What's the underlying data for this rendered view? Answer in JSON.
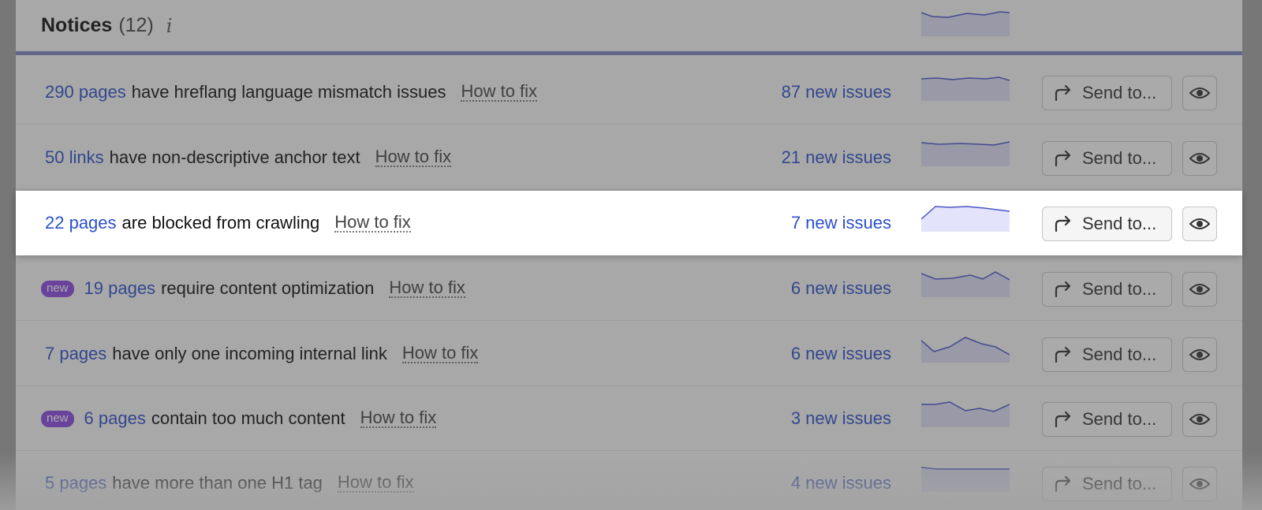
{
  "header": {
    "title": "Notices",
    "count": "(12)",
    "info_icon": "info-icon"
  },
  "rows": [
    {
      "count_text": "290 pages",
      "description": "have hreflang language mismatch issues",
      "how_to_fix": "How to fix",
      "new_issues": "87 new issues",
      "badge": "",
      "send_label": "Send to..."
    },
    {
      "count_text": "50 links",
      "description": "have non-descriptive anchor text",
      "how_to_fix": "How to fix",
      "new_issues": "21 new issues",
      "badge": "",
      "send_label": "Send to..."
    },
    {
      "count_text": "22 pages",
      "description": "are blocked from crawling",
      "how_to_fix": "How to fix",
      "new_issues": "7 new issues",
      "badge": "",
      "send_label": "Send to..."
    },
    {
      "count_text": "19 pages",
      "description": "require content optimization",
      "how_to_fix": "How to fix",
      "new_issues": "6 new issues",
      "badge": "new",
      "send_label": "Send to..."
    },
    {
      "count_text": "7 pages",
      "description": "have only one incoming internal link",
      "how_to_fix": "How to fix",
      "new_issues": "6 new issues",
      "badge": "",
      "send_label": "Send to..."
    },
    {
      "count_text": "6 pages",
      "description": "contain too much content",
      "how_to_fix": "How to fix",
      "new_issues": "3 new issues",
      "badge": "new",
      "send_label": "Send to..."
    },
    {
      "count_text": "5 pages",
      "description": "have more than one H1 tag",
      "how_to_fix": "How to fix",
      "new_issues": "4 new issues",
      "badge": "",
      "send_label": "Send to..."
    }
  ],
  "colors": {
    "link": "#2b50c9",
    "badge": "#8b49e0",
    "header_rule": "#7f86c4",
    "sparkline_fill": "#dcdcf7",
    "sparkline_line": "#4b55c8"
  },
  "icons": {
    "send": "share-arrow-icon",
    "view": "eye-icon"
  }
}
